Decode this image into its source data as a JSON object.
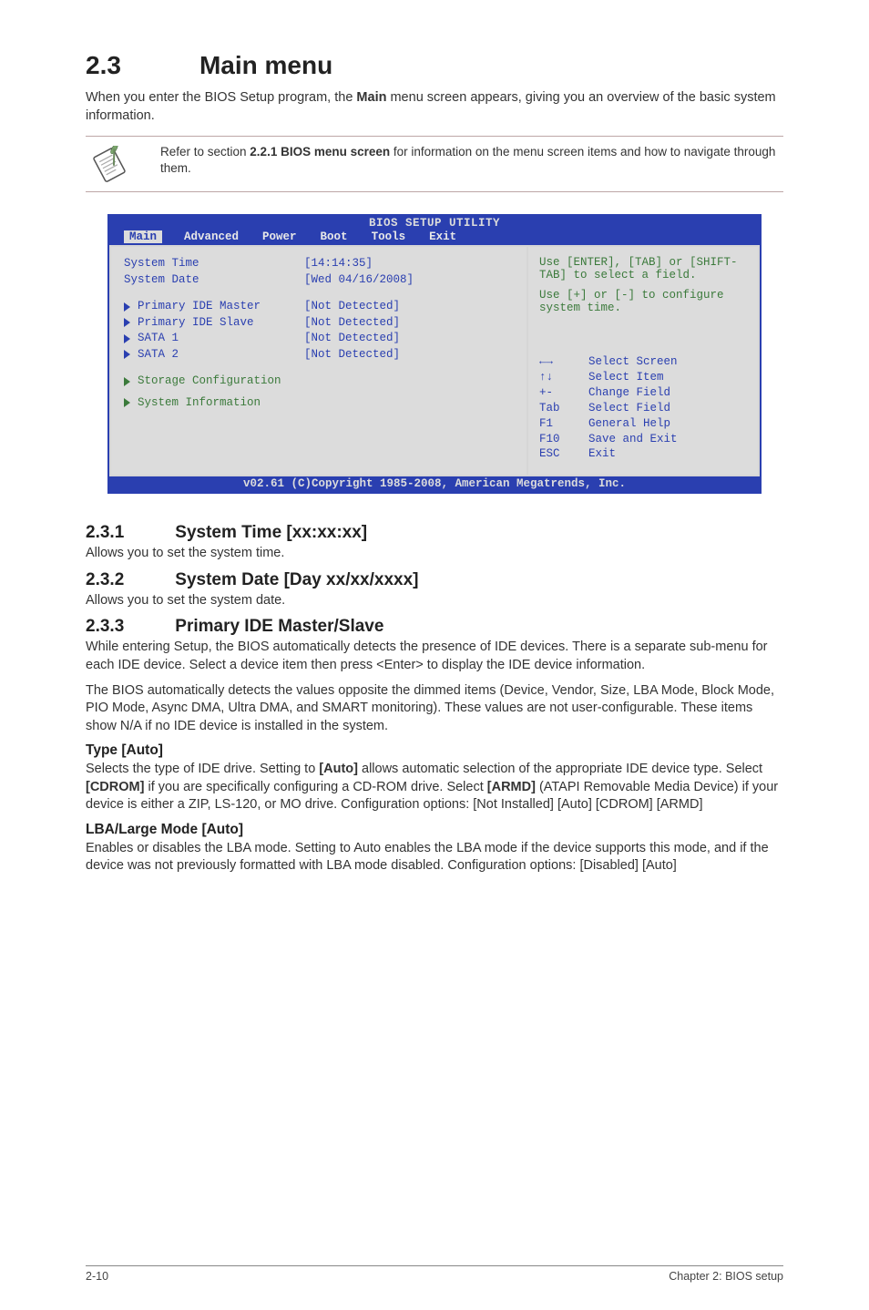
{
  "section": {
    "num": "2.3",
    "title": "Main menu"
  },
  "intro": {
    "pre": "When you enter the BIOS Setup program, the ",
    "bold": "Main",
    "post": " menu screen appears, giving you an overview of the basic system information."
  },
  "note": {
    "pre": "Refer to section ",
    "bold": "2.2.1 BIOS menu screen",
    "post": " for information on the menu screen items and how to navigate through them."
  },
  "bios": {
    "title": "BIOS SETUP UTILITY",
    "menu": [
      "Main",
      "Advanced",
      "Power",
      "Boot",
      "Tools",
      "Exit"
    ],
    "active_menu_index": 0,
    "rows1": [
      {
        "k": "System Time",
        "v": "[14:14:35]",
        "arrow": false
      },
      {
        "k": "System Date",
        "v": "[Wed 04/16/2008]",
        "arrow": false
      }
    ],
    "rows2": [
      {
        "k": "Primary IDE Master",
        "v": "[Not Detected]",
        "arrow": true
      },
      {
        "k": "Primary IDE Slave",
        "v": "[Not Detected]",
        "arrow": true
      },
      {
        "k": "SATA 1",
        "v": "[Not Detected]",
        "arrow": true
      },
      {
        "k": "SATA 2",
        "v": "[Not Detected]",
        "arrow": true
      }
    ],
    "rows3": [
      {
        "k": "Storage Configuration",
        "arrow": true,
        "green": true
      },
      {
        "k": "System Information",
        "arrow": true,
        "green": true
      }
    ],
    "help1": "Use [ENTER], [TAB] or [SHIFT-TAB] to select a field.",
    "help2": "Use [+] or [-] to configure system time.",
    "legend": [
      {
        "key": "←→",
        "label": "Select Screen"
      },
      {
        "key": "↑↓",
        "label": "Select Item"
      },
      {
        "key": "+-",
        "label": "Change Field"
      },
      {
        "key": "Tab",
        "label": "Select Field"
      },
      {
        "key": "F1",
        "label": "General Help"
      },
      {
        "key": "F10",
        "label": "Save and Exit"
      },
      {
        "key": "ESC",
        "label": "Exit"
      }
    ],
    "footer": "v02.61 (C)Copyright 1985-2008, American Megatrends, Inc."
  },
  "s231": {
    "num": "2.3.1",
    "title": "System Time [xx:xx:xx]",
    "body": "Allows you to set the system time."
  },
  "s232": {
    "num": "2.3.2",
    "title": "System Date [Day xx/xx/xxxx]",
    "body": "Allows you to set the system date."
  },
  "s233": {
    "num": "2.3.3",
    "title": "Primary IDE Master/Slave",
    "body1": "While entering Setup, the BIOS automatically detects the presence of IDE devices. There is a separate sub-menu for each IDE device. Select a device item then press <Enter> to display the IDE device information.",
    "body2": "The BIOS automatically detects the values opposite the dimmed items (Device, Vendor, Size, LBA Mode, Block Mode, PIO Mode, Async DMA, Ultra DMA, and SMART monitoring). These values are not user-configurable. These items show N/A if no IDE device is installed in the system."
  },
  "type_auto": {
    "title": "Type [Auto]",
    "p_pre1": "Selects the type of IDE drive. Setting to ",
    "b1": "[Auto]",
    "p_mid1": " allows automatic selection of the appropriate IDE device type. Select ",
    "b2": "[CDROM]",
    "p_mid2": " if you are specifically configuring a CD-ROM drive. Select ",
    "b3": "[ARMD]",
    "p_post": " (ATAPI Removable Media Device) if your device is either a ZIP, LS-120, or MO drive. Configuration options: [Not Installed] [Auto] [CDROM] [ARMD]"
  },
  "lba_mode": {
    "title": "LBA/Large Mode [Auto]",
    "body": "Enables or disables the LBA mode. Setting to Auto enables the LBA mode if the device supports this mode, and if the device was not previously formatted with LBA mode disabled. Configuration options: [Disabled] [Auto]"
  },
  "footer": {
    "left": "2-10",
    "right": "Chapter 2: BIOS setup"
  }
}
